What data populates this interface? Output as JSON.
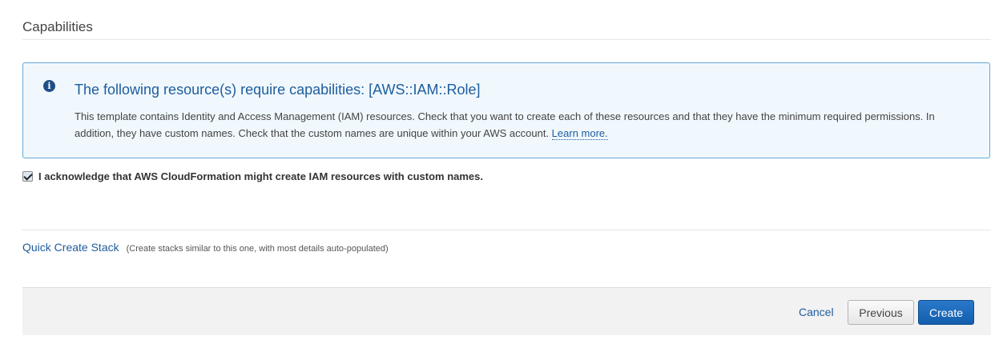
{
  "capabilities": {
    "section_title": "Capabilities",
    "info": {
      "icon": "info-icon",
      "title": "The following resource(s) require capabilities: [AWS::IAM::Role]",
      "body": "This template contains Identity and Access Management (IAM) resources. Check that you want to create each of these resources and that they have the minimum required permissions. In addition, they have custom names. Check that the custom names are unique within your AWS account. ",
      "learn_more": "Learn more."
    },
    "acknowledge": {
      "checked": true,
      "label": "I acknowledge that AWS CloudFormation might create IAM resources with custom names."
    }
  },
  "quick_create": {
    "link": "Quick Create Stack",
    "note": "(Create stacks similar to this one, with most details auto-populated)"
  },
  "footer": {
    "cancel": "Cancel",
    "previous": "Previous",
    "create": "Create"
  },
  "colors": {
    "accent": "#1e5c9e",
    "info_bg": "#f0f8fd",
    "info_border": "#64a7d6",
    "primary_button": "#1a6bbd"
  }
}
